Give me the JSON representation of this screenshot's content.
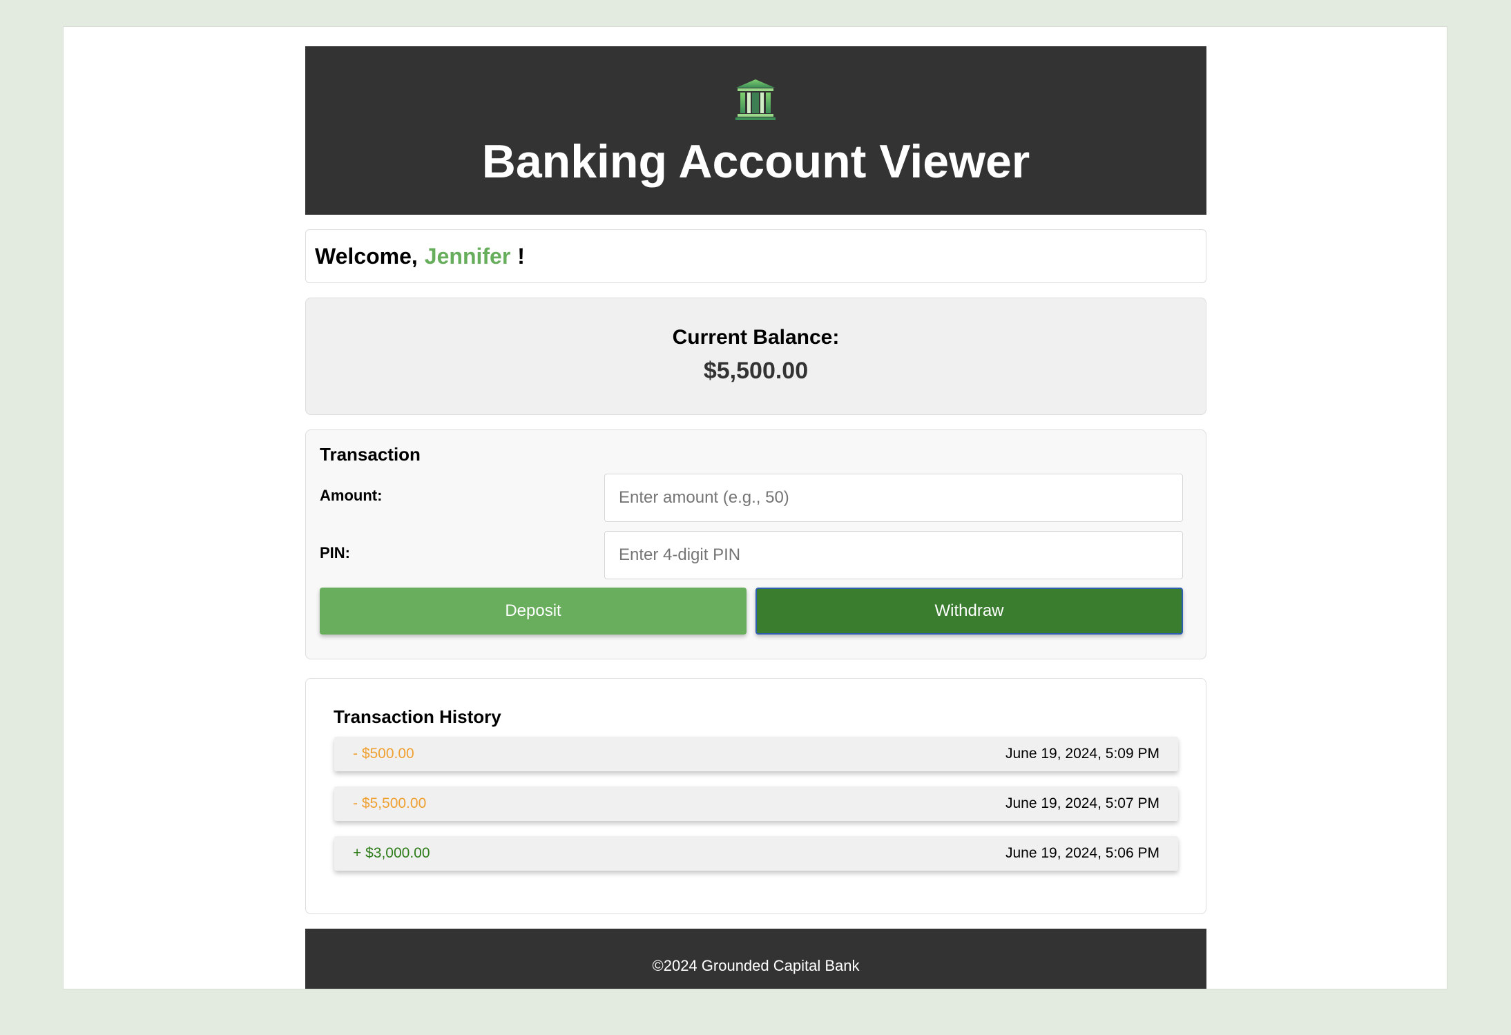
{
  "header": {
    "title": "Banking Account Viewer",
    "icon": "bank-icon"
  },
  "welcome": {
    "prefix": "Welcome,",
    "name": "Jennifer",
    "suffix": "!"
  },
  "balance": {
    "label": "Current Balance:",
    "amount": "$5,500.00"
  },
  "transaction": {
    "title": "Transaction",
    "amount_label": "Amount:",
    "amount_placeholder": "Enter amount (e.g., 50)",
    "amount_value": "",
    "pin_label": "PIN:",
    "pin_placeholder": "Enter 4-digit PIN",
    "pin_value": "",
    "deposit_label": "Deposit",
    "withdraw_label": "Withdraw"
  },
  "history": {
    "title": "Transaction History",
    "rows": [
      {
        "amount": "- $500.00",
        "date": "June 19, 2024, 5:09 PM",
        "type": "withdrawal"
      },
      {
        "amount": "- $5,500.00",
        "date": "June 19, 2024, 5:07 PM",
        "type": "withdrawal"
      },
      {
        "amount": "+ $3,000.00",
        "date": "June 19, 2024, 5:06 PM",
        "type": "deposit"
      }
    ]
  },
  "footer": {
    "text": "©2024 Grounded Capital Bank"
  },
  "colors": {
    "accent_green": "#66ad5c",
    "dark_green": "#3a7d2f",
    "header_bg": "#333333",
    "withdrawal_color": "#f0a030",
    "deposit_color": "#2e7d1a"
  }
}
